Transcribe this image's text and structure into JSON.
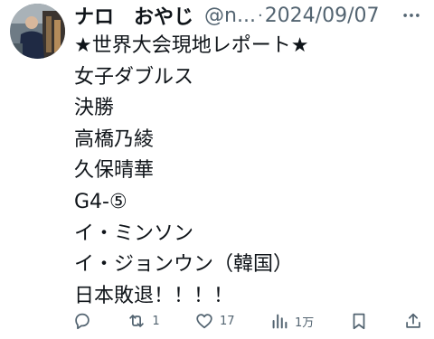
{
  "tweet": {
    "author": {
      "display_name": "ナロ　おやじ",
      "handle": "@n...",
      "avatar": "profile-photo"
    },
    "separator": "·",
    "date": "2024/09/07",
    "menu_icon": "more-horizontal-icon",
    "lines": [
      "★世界大会現地レポート★",
      "女子ダブルス",
      "決勝",
      "高橋乃綾",
      "久保晴華",
      "G4-⑤",
      "イ・ミンソン",
      "イ・ジョンウン（韓国）",
      "日本敗退！！！！"
    ]
  },
  "actions": {
    "reply": {
      "icon": "reply-icon",
      "count": ""
    },
    "retweet": {
      "icon": "retweet-icon",
      "count": "1"
    },
    "like": {
      "icon": "heart-icon",
      "count": "17"
    },
    "views": {
      "icon": "views-icon",
      "count": "1万"
    },
    "bookmark": {
      "icon": "bookmark-icon",
      "count": ""
    },
    "share": {
      "icon": "share-icon",
      "count": ""
    }
  },
  "colors": {
    "text": "#0f1419",
    "secondary": "#536471",
    "background": "#ffffff"
  }
}
